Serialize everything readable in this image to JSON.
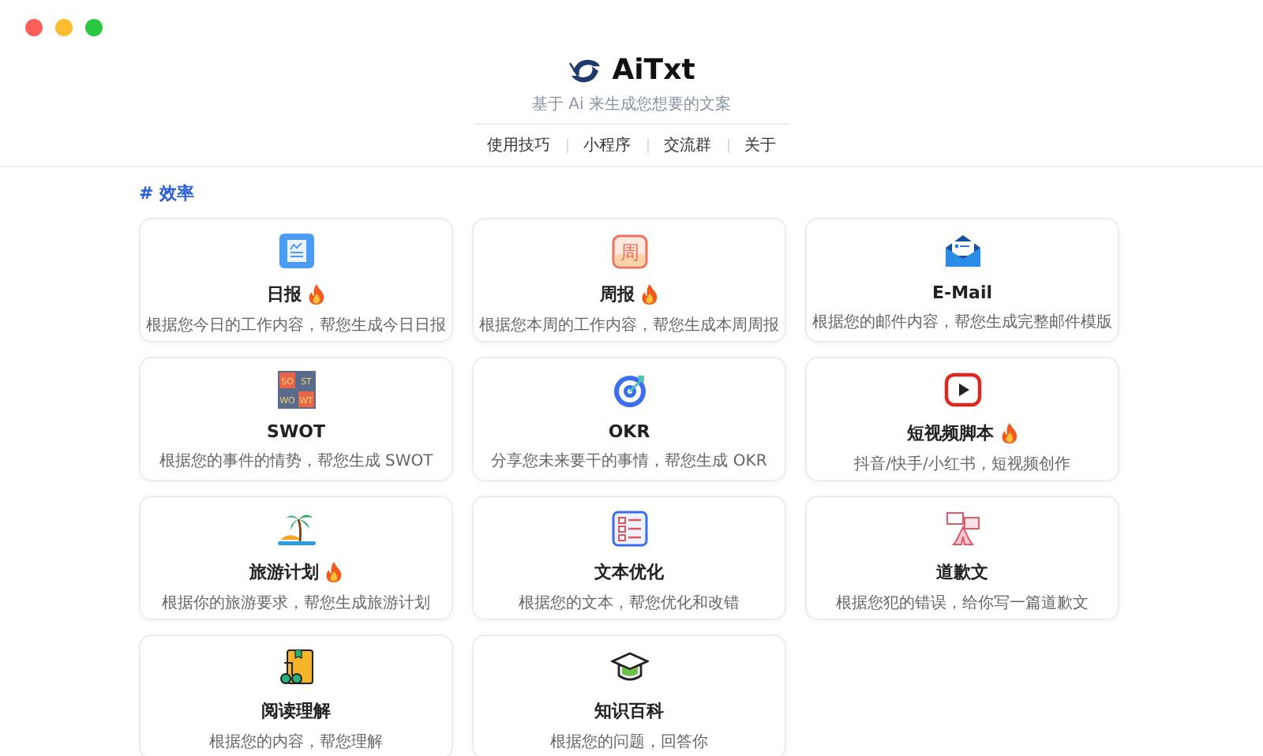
{
  "header": {
    "logo_text": "AiTxt",
    "subtitle": "基于 Ai 来生成您想要的文案",
    "nav": [
      "使用技巧",
      "小程序",
      "交流群",
      "关于"
    ]
  },
  "section": {
    "title": "# 效率",
    "cards": [
      {
        "kind": "daily",
        "title": "日报",
        "hot": true,
        "description": "根据您今日的工作内容，帮您生成今日日报"
      },
      {
        "kind": "weekly",
        "title": "周报",
        "hot": true,
        "description": "根据您本周的工作内容，帮您生成本周周报",
        "icon_text": "周"
      },
      {
        "kind": "email",
        "title": "E-Mail",
        "hot": false,
        "description": "根据您的邮件内容，帮您生成完整邮件模版"
      },
      {
        "kind": "swot",
        "title": "SWOT",
        "hot": false,
        "description": "根据您的事件的情势，帮您生成 SWOT",
        "tiles": [
          "SO",
          "ST",
          "WO",
          "WT"
        ]
      },
      {
        "kind": "okr",
        "title": "OKR",
        "hot": false,
        "description": "分享您未来要干的事情，帮您生成 OKR"
      },
      {
        "kind": "video",
        "title": "短视频脚本",
        "hot": true,
        "description": "抖音/快手/小红书，短视频创作"
      },
      {
        "kind": "travel",
        "title": "旅游计划",
        "hot": true,
        "description": "根据你的旅游要求，帮您生成旅游计划"
      },
      {
        "kind": "text",
        "title": "文本优化",
        "hot": false,
        "description": "根据您的文本，帮您优化和改错"
      },
      {
        "kind": "apology",
        "title": "道歉文",
        "hot": false,
        "description": "根据您犯的错误，给你写一篇道歉文"
      },
      {
        "kind": "reading",
        "title": "阅读理解",
        "hot": false,
        "description": "根据您的内容，帮您理解"
      },
      {
        "kind": "knowledge",
        "title": "知识百科",
        "hot": false,
        "description": "根据您的问题，回答你"
      }
    ]
  }
}
